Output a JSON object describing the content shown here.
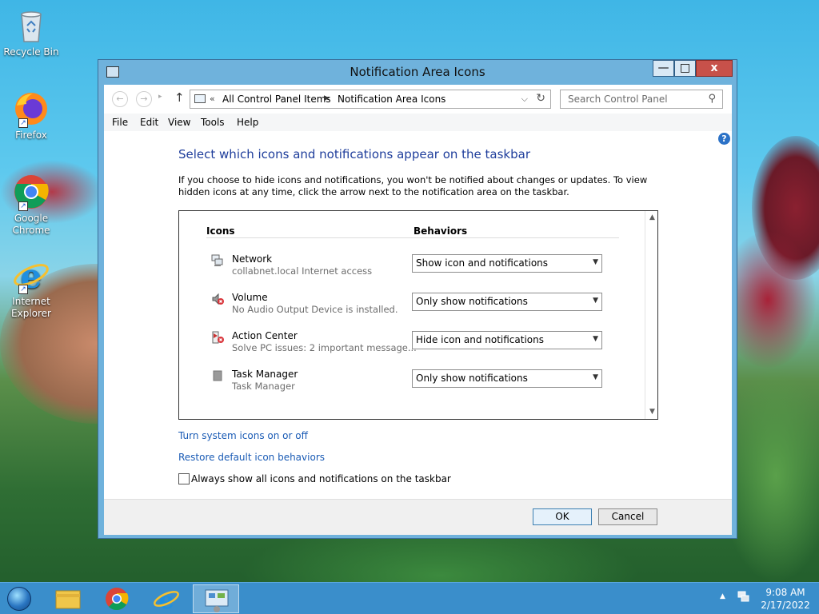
{
  "desktop": {
    "icons": [
      {
        "label": "Recycle Bin",
        "icon": "recycle-bin-icon"
      },
      {
        "label": "Firefox",
        "icon": "firefox-icon"
      },
      {
        "label": "Google Chrome",
        "icon": "chrome-icon"
      },
      {
        "label": "Internet Explorer",
        "icon": "ie-icon"
      }
    ]
  },
  "window": {
    "title": "Notification Area Icons",
    "controls": {
      "minimize": "—",
      "maximize": "□",
      "close": "x"
    }
  },
  "address_bar": {
    "prefix": "«",
    "crumbs": [
      "All Control Panel Items",
      "Notification Area Icons"
    ],
    "search_placeholder": "Search Control Panel"
  },
  "menu": [
    "File",
    "Edit",
    "View",
    "Tools",
    "Help"
  ],
  "content": {
    "heading": "Select which icons and notifications appear on the taskbar",
    "description": "If you choose to hide icons and notifications, you won't be notified about changes or updates. To view hidden icons at any time, click the arrow next to the notification area on the taskbar.",
    "columns": {
      "icons": "Icons",
      "behaviors": "Behaviors"
    },
    "rows": [
      {
        "name": "Network",
        "sub": "collabnet.local Internet access",
        "behavior": "Show icon and notifications",
        "icon": "network-icon"
      },
      {
        "name": "Volume",
        "sub": "No Audio Output Device is installed.",
        "behavior": "Only show notifications",
        "icon": "volume-icon"
      },
      {
        "name": "Action Center",
        "sub": "Solve PC issues: 2 important message...",
        "behavior": "Hide icon and notifications",
        "icon": "action-center-icon"
      },
      {
        "name": "Task Manager",
        "sub": "Task Manager",
        "behavior": "Only show notifications",
        "icon": "task-manager-icon"
      }
    ],
    "links": {
      "system_icons": "Turn system icons on or off",
      "restore": "Restore default icon behaviors"
    },
    "checkbox": {
      "label": "Always show all icons and notifications on the taskbar",
      "checked": false
    }
  },
  "buttons": {
    "ok": "OK",
    "cancel": "Cancel"
  },
  "taskbar": {
    "items": [
      "start-orb",
      "file-explorer-icon",
      "chrome-icon",
      "ie-icon",
      "control-panel-icon"
    ],
    "clock_time": "9:08 AM",
    "clock_date": "2/17/2022"
  },
  "colors": {
    "heading": "#1e3d9b",
    "link": "#1a5bb5",
    "taskbar": "#3a8ecb",
    "close_button": "#c7514a"
  }
}
